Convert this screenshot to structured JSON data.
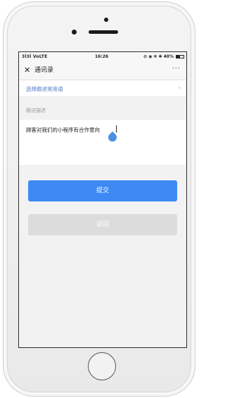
{
  "status_bar": {
    "carrier": "3İ3İ VoLTE",
    "time": "16:26",
    "indicators": "⊘ ◉ ❁ ✱ 40%"
  },
  "nav": {
    "close_icon": "close-icon",
    "title": "通讯录",
    "more": "···"
  },
  "followup_phrase_row": {
    "label": "选择跟进常用语",
    "chevron": "›"
  },
  "description": {
    "section_label": "跟进描述",
    "value": "顾客对我们的小程序有合作意向"
  },
  "buttons": {
    "submit": "提交",
    "back": "返回"
  },
  "colors": {
    "primary": "#3d8af5",
    "link": "#4d79c6",
    "disabled": "#dcdcdc"
  }
}
